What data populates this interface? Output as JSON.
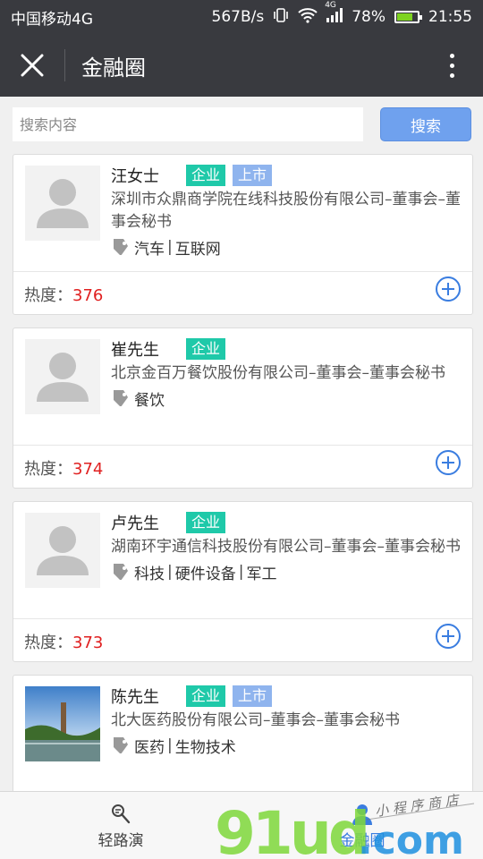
{
  "status_bar": {
    "carrier": "中国移动4G",
    "speed": "567B/s",
    "network_badge": "4G",
    "battery": "78%",
    "battery_level": 0.78,
    "time": "21:55"
  },
  "title_bar": {
    "title": "金融圈"
  },
  "search": {
    "placeholder": "搜索内容",
    "button_label": "搜索"
  },
  "cards": [
    {
      "name": "汪女士",
      "badges": [
        "企业",
        "上市"
      ],
      "company": "深圳市众鼎商学院在线科技股份有限公司–董事会–董事会秘书",
      "tags": [
        "汽车",
        "互联网"
      ],
      "heat_label": "热度：",
      "heat_value": "376",
      "avatar": "placeholder"
    },
    {
      "name": "崔先生",
      "badges": [
        "企业"
      ],
      "company": "北京金百万餐饮股份有限公司–董事会–董事会秘书",
      "tags": [
        "餐饮"
      ],
      "heat_label": "热度：",
      "heat_value": "374",
      "avatar": "placeholder"
    },
    {
      "name": "卢先生",
      "badges": [
        "企业"
      ],
      "company": "湖南环宇通信科技股份有限公司–董事会–董事会秘书",
      "tags": [
        "科技",
        "硬件设备",
        "军工"
      ],
      "heat_label": "热度：",
      "heat_value": "373",
      "avatar": "placeholder"
    },
    {
      "name": "陈先生",
      "badges": [
        "企业",
        "上市"
      ],
      "company": "北大医药股份有限公司–董事会–董事会秘书",
      "tags": [
        "医药",
        "生物技术"
      ],
      "avatar": "photo"
    }
  ],
  "bottom_nav": [
    {
      "label": "轻路演",
      "icon": "roadshow-icon",
      "active": false
    },
    {
      "label": "金融圈",
      "icon": "user-icon",
      "active": true
    }
  ],
  "watermark": {
    "logo": "91ud.com",
    "tagline": "小程序商店"
  },
  "colors": {
    "header_bg": "#393a3f",
    "company_badge": "#1fc9a9",
    "listed_badge": "#8fb4ee",
    "search_button": "#6fa1ee",
    "heat_value": "#e02020",
    "accent": "#3a7de0"
  }
}
